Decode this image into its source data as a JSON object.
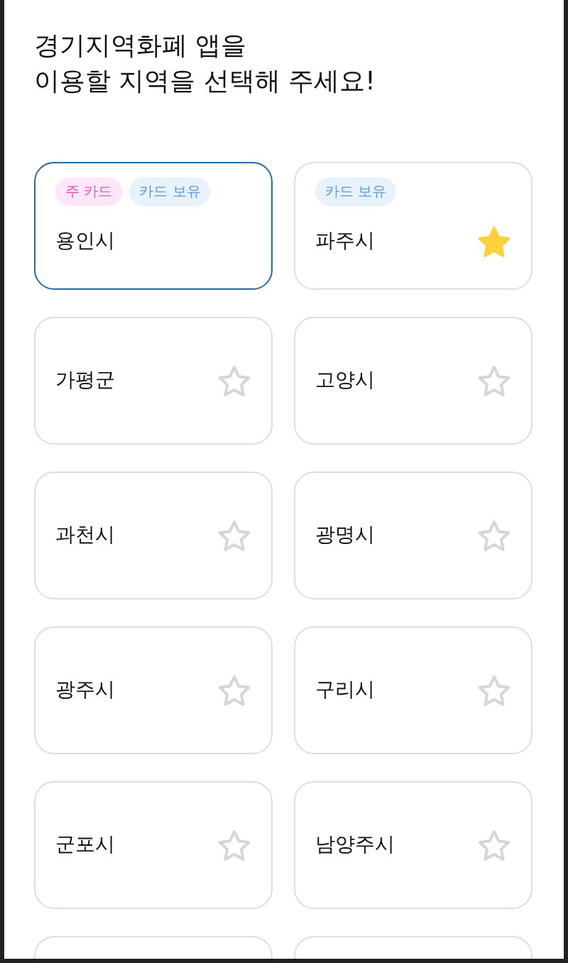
{
  "title_lines": [
    "경기지역화폐 앱을",
    "이용할 지역을 선택해 주세요!"
  ],
  "regions": [
    {
      "name": "용인시",
      "selected": true,
      "tags": [
        {
          "kind": "main",
          "label": "주 카드"
        },
        {
          "kind": "owned",
          "label": "카드 보유"
        }
      ]
    },
    {
      "name": "파주시",
      "selected": false,
      "favorite": true,
      "tags": [
        {
          "kind": "owned",
          "label": "카드 보유"
        }
      ]
    },
    {
      "name": "가평군",
      "selected": false,
      "favorite": false
    },
    {
      "name": "고양시",
      "selected": false,
      "favorite": false
    },
    {
      "name": "과천시",
      "selected": false,
      "favorite": false
    },
    {
      "name": "광명시",
      "selected": false,
      "favorite": false
    },
    {
      "name": "광주시",
      "selected": false,
      "favorite": false
    },
    {
      "name": "구리시",
      "selected": false,
      "favorite": false
    },
    {
      "name": "군포시",
      "selected": false,
      "favorite": false
    },
    {
      "name": "남양주시",
      "selected": false,
      "favorite": false
    },
    {
      "selected": false
    },
    {
      "selected": false
    }
  ]
}
